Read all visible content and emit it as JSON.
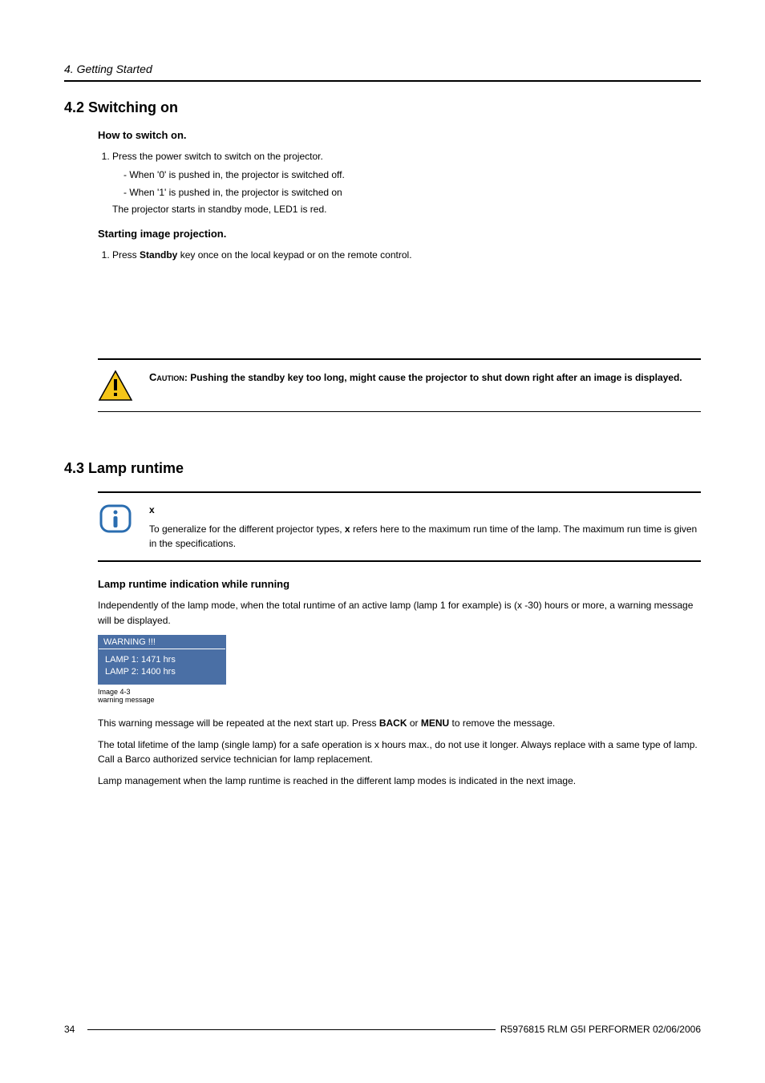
{
  "header": {
    "chapter": "4. Getting Started"
  },
  "section_4_2": {
    "title": "4.2   Switching on",
    "howto_title": "How to switch on.",
    "step1": "Press the power switch to switch on the projector.",
    "dash1": "When '0' is pushed in, the projector is switched off.",
    "dash2": "When '1' is pushed in, the projector is switched on",
    "note": "The projector starts in standby mode, LED1 is red.",
    "start_title": "Starting image projection.",
    "start_step_pre": "Press ",
    "start_step_bold": "Standby",
    "start_step_post": " key once on the local keypad or on the remote control."
  },
  "caution": {
    "lead": "Caution",
    "text": ": Pushing the standby key too long, might cause the projector to shut down right after an image is displayed."
  },
  "section_4_3": {
    "title": "4.3   Lamp runtime",
    "info_term": "x",
    "info_text_pre": "To generalize for the different projector types, ",
    "info_text_bold": "x",
    "info_text_post": " refers here to the maximum run time of the lamp. The maximum run time is given in the specifications.",
    "ind_title": "Lamp runtime indication while running",
    "ind_para": "Independently of the lamp mode, when the total runtime of an active lamp (lamp 1 for example) is (x -30) hours or more, a warning message will be displayed.",
    "warning_title": "WARNING !!!",
    "lamp1": "LAMP 1: 1471 hrs",
    "lamp2": "LAMP 2: 1400 hrs",
    "img_caption_line1": "Image 4-3",
    "img_caption_line2": "warning message",
    "repeat_pre": "This warning message will be repeated at the next start up. Press ",
    "repeat_back": "BACK",
    "repeat_mid": " or ",
    "repeat_menu": "MENU",
    "repeat_post": " to remove the message.",
    "lifetime": "The total lifetime of the lamp (single lamp) for a safe operation is x hours max., do not use it longer. Always replace with a same type of lamp. Call a Barco authorized service technician for lamp replacement.",
    "mgmt": "Lamp management when the lamp runtime is reached in the different lamp modes is indicated in the next image."
  },
  "footer": {
    "page": "34",
    "doc": "R5976815  RLM G5I PERFORMER  02/06/2006"
  }
}
